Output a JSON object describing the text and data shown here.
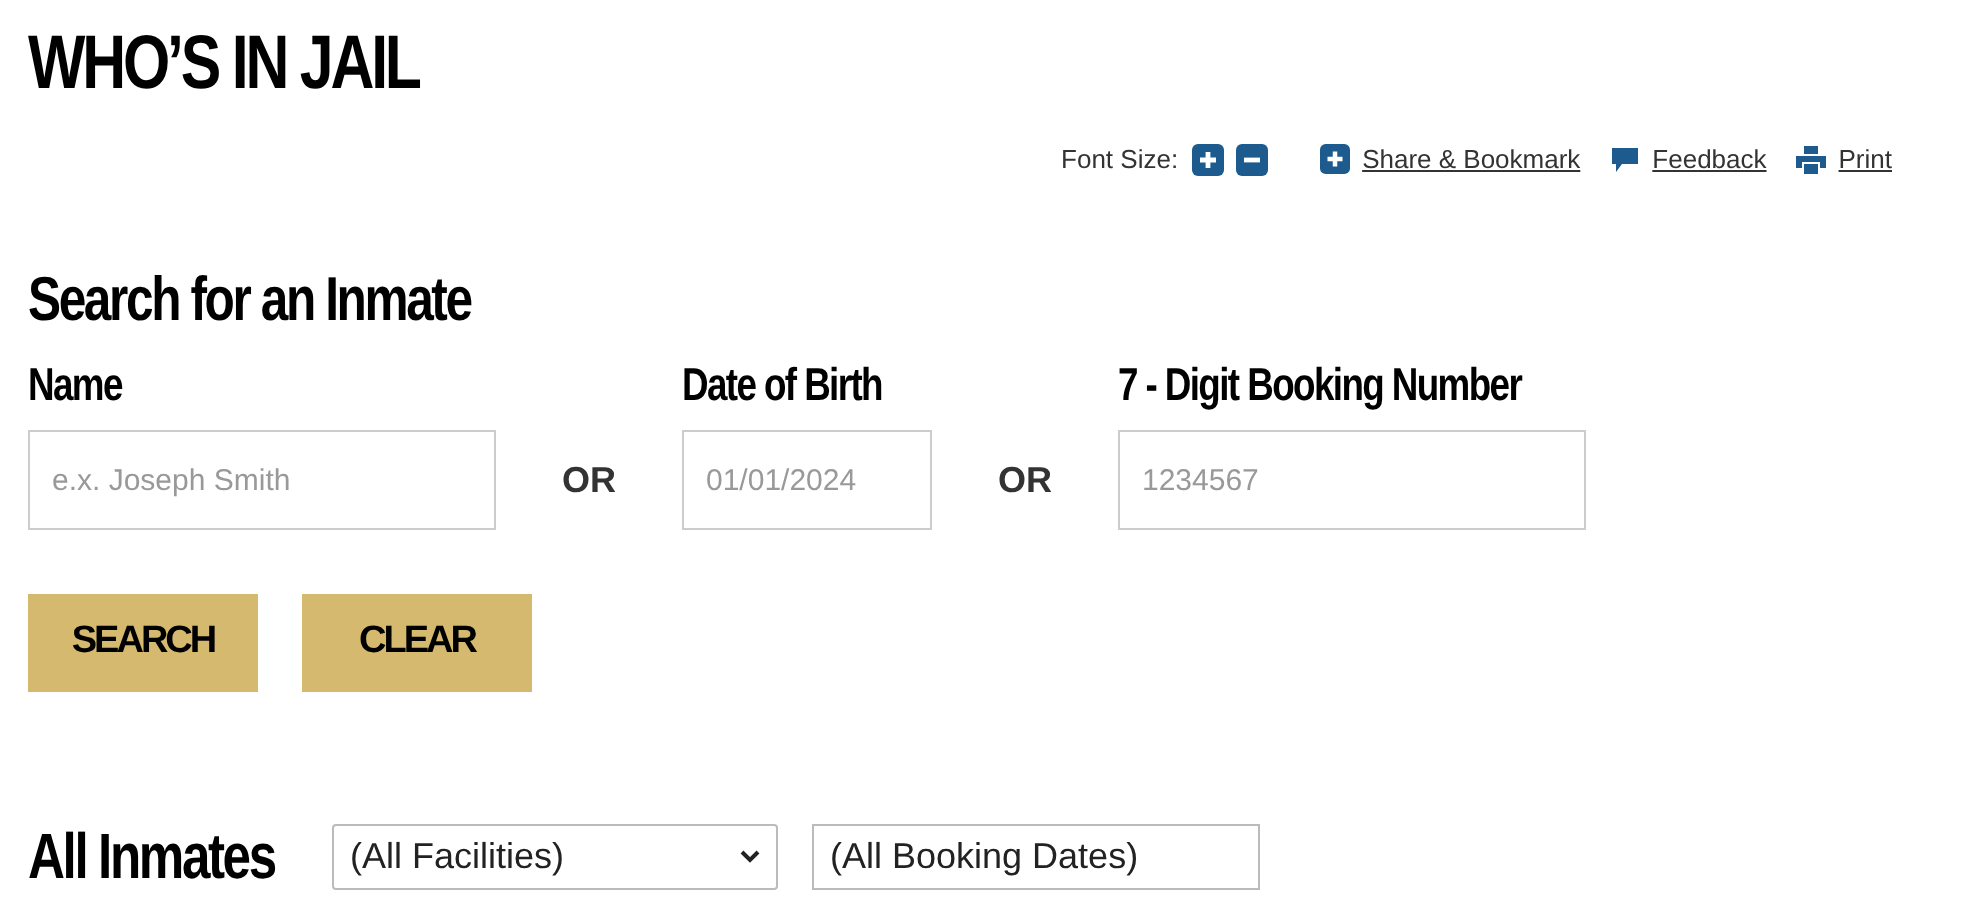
{
  "title": "WHO’S IN JAIL",
  "toolbar": {
    "font_size_label": "Font Size:",
    "links": [
      {
        "kind": "share",
        "label": "Share & Bookmark"
      },
      {
        "kind": "feedback",
        "label": "Feedback"
      },
      {
        "kind": "print",
        "label": "Print"
      }
    ]
  },
  "search": {
    "heading": "Search for an Inmate",
    "fields": [
      {
        "label": "Name",
        "placeholder": "e.x. Joseph Smith",
        "kind": "text"
      },
      {
        "label": "Date of Birth",
        "placeholder": "01/01/2024",
        "kind": "date"
      },
      {
        "label": "7 - Digit Booking Number",
        "placeholder": "1234567",
        "kind": "number"
      }
    ],
    "separators": [
      "OR",
      "OR"
    ],
    "buttons": [
      "SEARCH",
      "CLEAR"
    ]
  },
  "all_inmates": {
    "heading": "All Inmates",
    "facility_select": "(All Facilities)",
    "booking_dates": "(All Booking Dates)"
  }
}
